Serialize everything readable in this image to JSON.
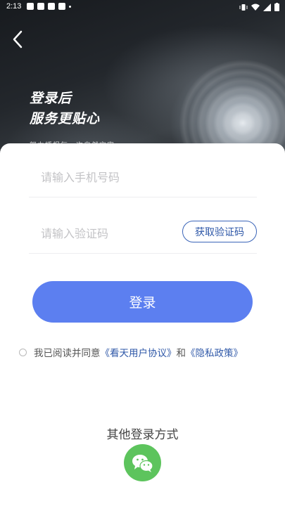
{
  "status_bar": {
    "time": "2:13"
  },
  "hero": {
    "title_line1": "登录后",
    "title_line2": "服务更贴心",
    "subtitle": "努力播报每一次自然灾害"
  },
  "form": {
    "phone_placeholder": "请输入手机号码",
    "code_placeholder": "请输入验证码",
    "get_code_label": "获取验证码",
    "login_label": "登录"
  },
  "agreement": {
    "prefix": "我已阅读并同意",
    "user_agreement": "《看天用户协议》",
    "and": "和",
    "privacy_policy": "《隐私政策》"
  },
  "other_login": {
    "title": "其他登录方式",
    "wechat_icon": "wechat-icon"
  },
  "colors": {
    "primary": "#5c7ff0",
    "link": "#2f58a8",
    "wechat": "#5dc45d"
  }
}
